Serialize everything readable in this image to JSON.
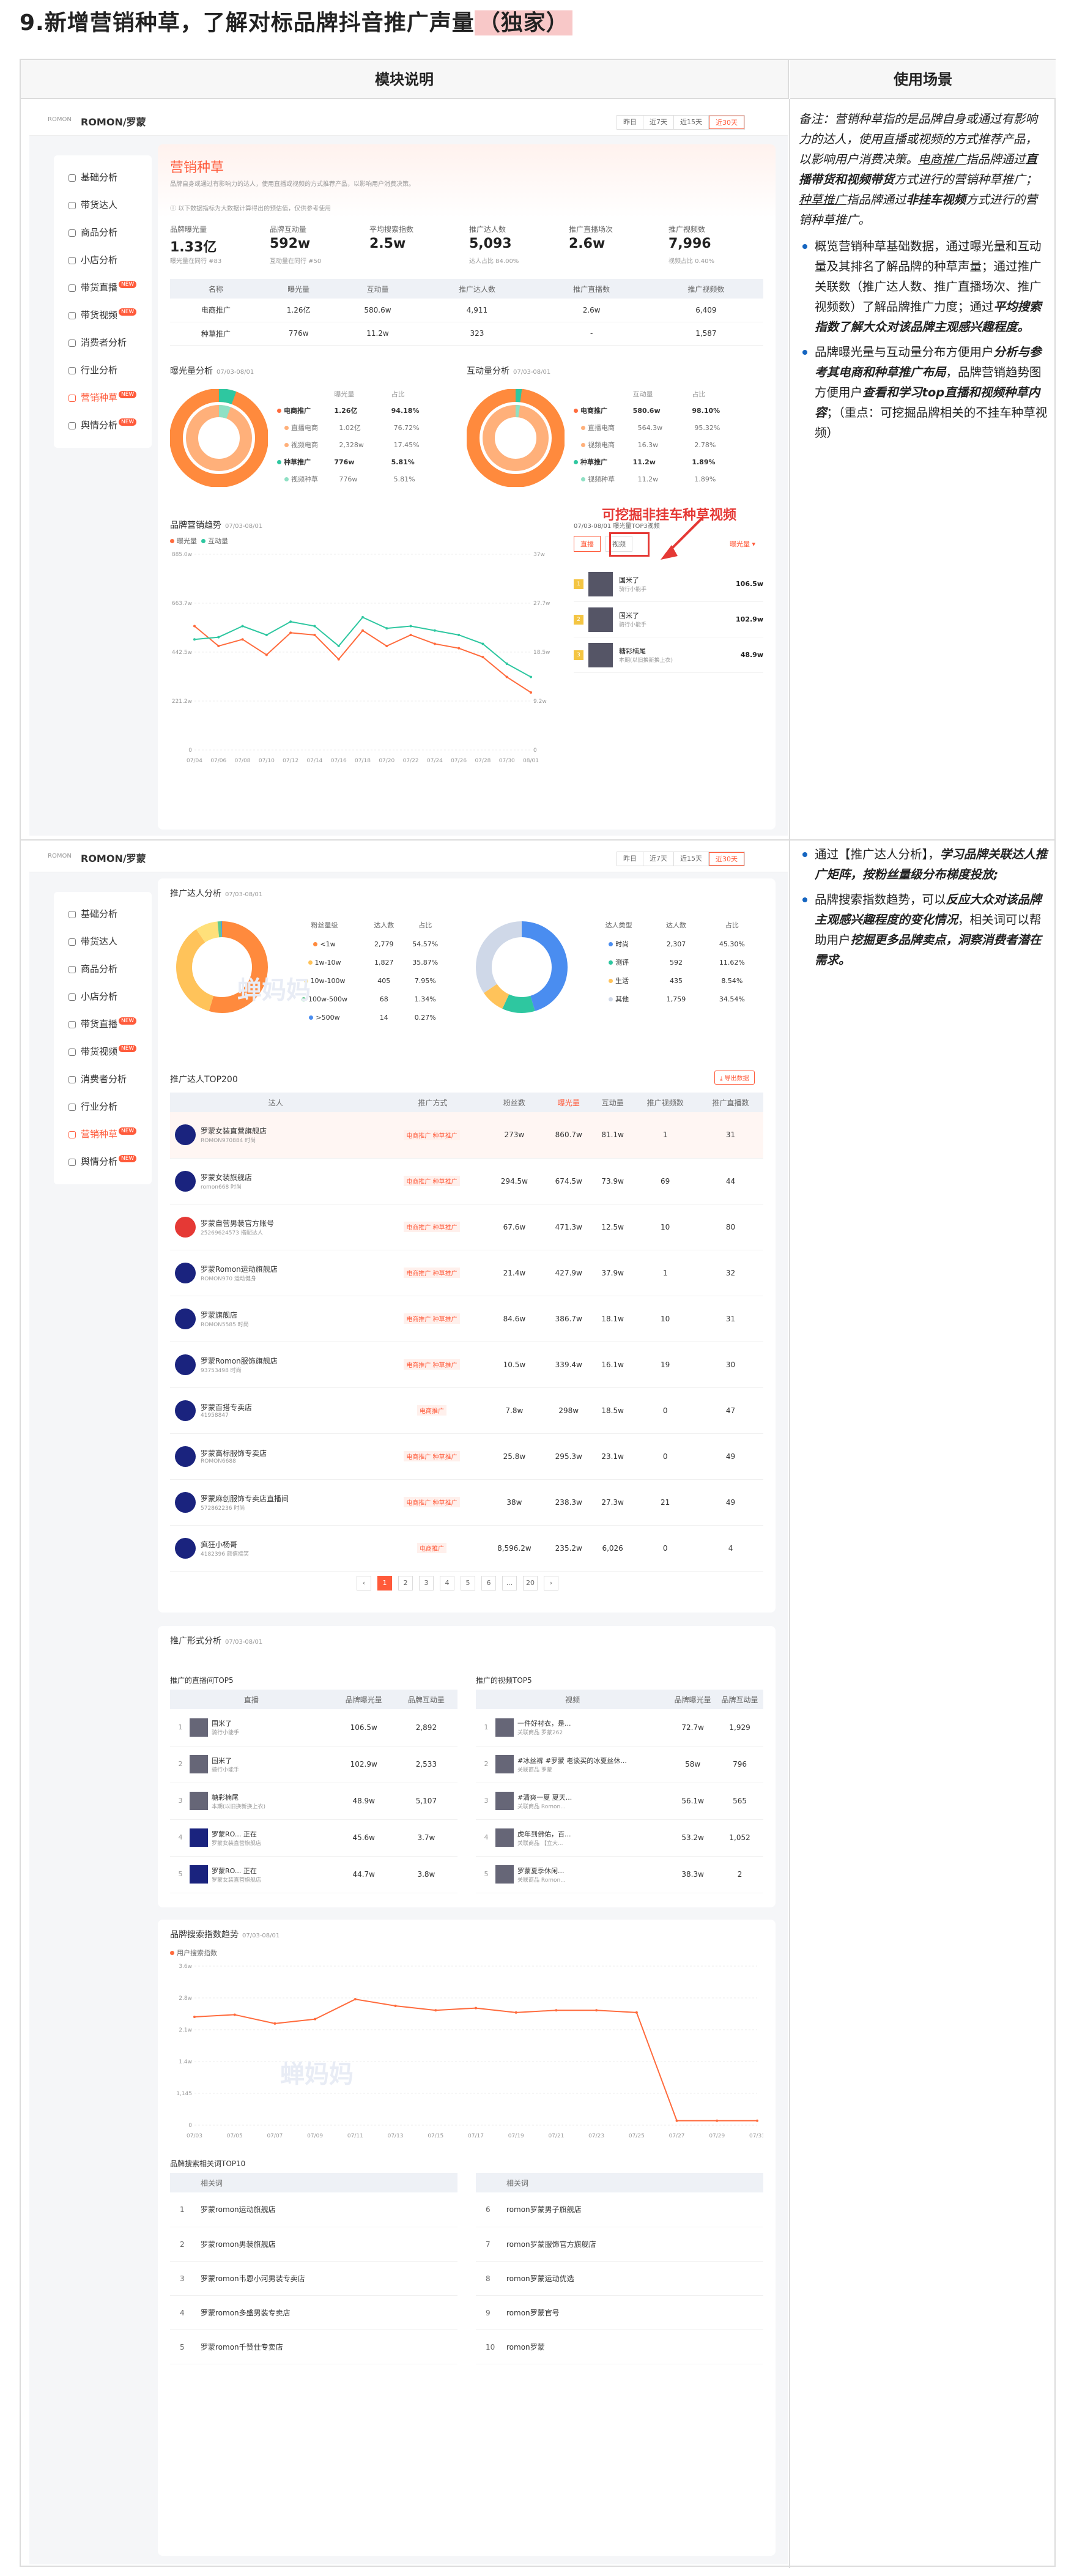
{
  "title": {
    "prefix": "9.新增营销种草，了解对标品牌抖音推广声量",
    "highlight": "（独家）"
  },
  "table_headers": {
    "left": "模块说明",
    "right": "使用场景"
  },
  "notes": {
    "n1_pre": "备注：营销种草指的是品牌自身或通过有影响力的达人，使用直播或视频的方式推荐产品，以影响用户消费决策。",
    "n1_u1": "电商推广",
    "n1_mid": "指品牌通过",
    "n1_b1": "直播带货和视频带货",
    "n1_mid2": "方式进行的营销种草推广；",
    "n1_u2": "种草推广",
    "n1_mid3": "指品牌通过",
    "n1_b2": "非挂车视频",
    "n1_end": "方式进行的营销种草推广。",
    "b1_a": "概览营销种草基础数据，通过曝光量和互动量及其排名了解品牌的种草声量；通过推广关联数（推广达人数、推广直播场次、推广视频数）了解品牌推广力度；通过",
    "b1_b": "平均搜索指数了解大众对该品牌主观感兴趣程度。",
    "b2_a": "品牌曝光量与互动量分布方便用户",
    "b2_b": "分析与参考其电商和种草推广布局",
    "b2_c": "，品牌营销趋势图方便用户",
    "b2_d": "查看和学习top直播和视频种草内容",
    "b2_e": "；（重点：可挖掘品牌相关的不挂车种草视频）",
    "b3_a": "通过【推广达人分析】，",
    "b3_b": "学习品牌关联达人推广矩阵，按粉丝量级分布梯度投放;",
    "b4_a": "品牌搜索指数趋势，可以",
    "b4_b": "反应大众对该品牌主观感兴趣程度的变化情况",
    "b4_c": "，相关词可以帮助用户",
    "b4_d": "挖掘更多品牌卖点，洞察消费者潜在需求。"
  },
  "app": {
    "logo": "ROMON",
    "brand": "ROMON/罗蒙",
    "ranges": [
      "昨日",
      "近7天",
      "近15天",
      "近30天"
    ],
    "range_selected": 3,
    "sidebar": [
      "基础分析",
      "带货达人",
      "商品分析",
      "小店分析",
      "带货直播",
      "带货视频",
      "消费者分析",
      "行业分析",
      "营销种草",
      "舆情分析"
    ],
    "sidebar_new": [
      false,
      false,
      false,
      false,
      true,
      true,
      false,
      false,
      true,
      true
    ],
    "sidebar_selected": 8
  },
  "overview": {
    "title": "营销种草",
    "desc": "品牌自身或通过有影响力的达人，使用直播或视频的方式推荐产品，以影响用户消费决策。",
    "tip": "以下数据指标为大数据计算得出的预估值，仅供参考使用",
    "metrics": [
      {
        "label": "品牌曝光量",
        "value": "1.33亿",
        "sub": "曝光量在同行 #83"
      },
      {
        "label": "品牌互动量",
        "value": "592w",
        "sub": "互动量在同行 #50"
      },
      {
        "label": "平均搜索指数",
        "value": "2.5w",
        "sub": ""
      },
      {
        "label": "推广达人数",
        "value": "5,093",
        "sub": "达人占比 84.00%"
      },
      {
        "label": "推广直播场次",
        "value": "2.6w",
        "sub": ""
      },
      {
        "label": "推广视频数",
        "value": "7,996",
        "sub": "视频占比 0.40%"
      }
    ],
    "table_head": [
      "名称",
      "曝光量",
      "互动量",
      "推广达人数",
      "推广直播数",
      "推广视频数"
    ],
    "table_rows": [
      [
        "电商推广",
        "1.26亿",
        "580.6w",
        "4,911",
        "2.6w",
        "6,409"
      ],
      [
        "种草推广",
        "776w",
        "11.2w",
        "323",
        "-",
        "1,587"
      ]
    ]
  },
  "distribution": {
    "left_title": "曝光量分析",
    "left_date": "07/03-08/01",
    "right_title": "互动量分析",
    "right_date": "07/03-08/01",
    "cols": [
      "曝光量",
      "占比"
    ],
    "cols_r": [
      "互动量",
      "占比"
    ],
    "left_rows": [
      [
        "电商推广",
        "1.26亿",
        "94.18%"
      ],
      [
        "直播电商",
        "1.02亿",
        "76.72%"
      ],
      [
        "视频电商",
        "2,328w",
        "17.45%"
      ],
      [
        "种草推广",
        "776w",
        "5.81%"
      ],
      [
        "视频种草",
        "776w",
        "5.81%"
      ]
    ],
    "right_rows": [
      [
        "电商推广",
        "580.6w",
        "98.10%"
      ],
      [
        "直播电商",
        "564.3w",
        "95.32%"
      ],
      [
        "视频电商",
        "16.3w",
        "2.78%"
      ],
      [
        "种草推广",
        "11.2w",
        "1.89%"
      ],
      [
        "视频种草",
        "11.2w",
        "1.89%"
      ]
    ],
    "left_center": "电商推广",
    "right_center": "电商推广"
  },
  "trend": {
    "title": "品牌营销趋势",
    "date": "07/03-08/01",
    "series_names": [
      "曝光量",
      "互动量"
    ],
    "buttons": [
      "直播",
      "视频"
    ],
    "top_title": "07/03-08/01 曝光量TOP3视频",
    "sort": "曝光量",
    "callout": "可挖掘非挂车种草视频",
    "top": [
      {
        "name": "国米了",
        "sub": "骑行小能手",
        "value": "106.5w"
      },
      {
        "name": "国米了",
        "sub": "骑行小能手",
        "value": "102.9w"
      },
      {
        "name": "糖彩楠尾",
        "sub": "本期(以旧换新换上衣)",
        "value": "48.9w"
      }
    ]
  },
  "chart_data": [
    {
      "type": "line",
      "title": "品牌营销趋势",
      "x": [
        "07/04",
        "07/06",
        "07/08",
        "07/10",
        "07/12",
        "07/14",
        "07/16",
        "07/18",
        "07/20",
        "07/22",
        "07/24",
        "07/26",
        "07/28",
        "07/30",
        "08/01"
      ],
      "yticks_left": [
        "0",
        "221.2w",
        "442.5w",
        "663.7w",
        "885.0w"
      ],
      "yticks_right": [
        "0",
        "9.2w",
        "18.5w",
        "27.7w",
        "37w"
      ],
      "ylim": [
        0,
        885
      ],
      "series": [
        {
          "name": "曝光量",
          "color": "#ff6b3d",
          "values": [
            560,
            470,
            500,
            430,
            530,
            520,
            410,
            540,
            470,
            520,
            480,
            460,
            420,
            330,
            260
          ]
        },
        {
          "name": "互动量",
          "color": "#2ec7a0",
          "values": [
            500,
            510,
            560,
            520,
            580,
            560,
            470,
            600,
            550,
            560,
            540,
            520,
            480,
            390,
            330
          ]
        }
      ]
    },
    {
      "type": "line",
      "title": "品牌搜索指数趋势",
      "x": [
        "07/03",
        "07/05",
        "07/07",
        "07/09",
        "07/11",
        "07/13",
        "07/15",
        "07/17",
        "07/19",
        "07/21",
        "07/23",
        "07/25",
        "07/27",
        "07/29",
        "07/31"
      ],
      "yticks": [
        "0",
        "1,145",
        "1.4w",
        "2.1w",
        "2.8w",
        "3.6w"
      ],
      "ylim": [
        0,
        3.6
      ],
      "series": [
        {
          "name": "用户搜索指数",
          "color": "#ff6b3d",
          "values": [
            2.45,
            2.5,
            2.3,
            2.4,
            2.85,
            2.7,
            2.6,
            2.65,
            2.55,
            2.6,
            2.6,
            2.55,
            0.1,
            0.1,
            0.1
          ]
        }
      ]
    }
  ],
  "influencer": {
    "title": "推广达人分析",
    "date": "07/03-08/01",
    "fan_head": [
      "粉丝量级",
      "达人数",
      "占比"
    ],
    "fan_rows": [
      [
        "<1w",
        "2,779",
        "54.57%"
      ],
      [
        "1w-10w",
        "1,827",
        "35.87%"
      ],
      [
        "10w-100w",
        "405",
        "7.95%"
      ],
      [
        "100w-500w",
        "68",
        "1.34%"
      ],
      [
        ">500w",
        "14",
        "0.27%"
      ]
    ],
    "fan_colors": [
      "#ff8a3d",
      "#ffc35a",
      "#ffe07a",
      "#62c98e",
      "#4a8df0"
    ],
    "type_head": [
      "达人类型",
      "达人数",
      "占比"
    ],
    "type_rows": [
      [
        "时尚",
        "2,307",
        "45.30%"
      ],
      [
        "测评",
        "592",
        "11.62%"
      ],
      [
        "生活",
        "435",
        "8.54%"
      ],
      [
        "其他",
        "1,759",
        "34.54%"
      ]
    ],
    "type_colors": [
      "#4a8df0",
      "#2ec7a0",
      "#ffc35a",
      "#cfd8e8"
    ],
    "top_title": "推广达人TOP200",
    "export": "导出数据",
    "head": [
      "达人",
      "推广方式",
      "粉丝数",
      "曝光量",
      "互动量",
      "推广视频数",
      "推广直播数"
    ],
    "rows": [
      [
        "罗蒙女装直营旗舰店",
        "ROMON970884 时尚",
        "电商推广 种草推广",
        "273w",
        "860.7w",
        "81.1w",
        "1",
        "31"
      ],
      [
        "罗蒙女装旗舰店",
        "romon668 时尚",
        "电商推广 种草推广",
        "294.5w",
        "674.5w",
        "73.9w",
        "69",
        "44"
      ],
      [
        "罗蒙自营男装官方账号",
        "25269624573 搭配达人",
        "电商推广 种草推广",
        "67.6w",
        "471.3w",
        "12.5w",
        "10",
        "80"
      ],
      [
        "罗蒙Romon运动旗舰店",
        "ROMON970 运动健身",
        "电商推广 种草推广",
        "21.4w",
        "427.9w",
        "37.9w",
        "1",
        "32"
      ],
      [
        "罗蒙旗舰店",
        "ROMON5585 时尚",
        "电商推广 种草推广",
        "84.6w",
        "386.7w",
        "18.1w",
        "10",
        "31"
      ],
      [
        "罗蒙Romon服饰旗舰店",
        "93753498 时尚",
        "电商推广 种草推广",
        "10.5w",
        "339.4w",
        "16.1w",
        "19",
        "30"
      ],
      [
        "罗蒙百搭专卖店",
        "41958847",
        "电商推广",
        "7.8w",
        "298w",
        "18.5w",
        "0",
        "47"
      ],
      [
        "罗蒙高标服饰专卖店",
        "ROMON6688",
        "电商推广 种草推广",
        "25.8w",
        "295.3w",
        "23.1w",
        "0",
        "49"
      ],
      [
        "罗蒙麻创服饰专卖店直播间",
        "572862236 时尚",
        "电商推广 种草推广",
        "38w",
        "238.3w",
        "27.3w",
        "21",
        "49"
      ],
      [
        "疯狂小杨哥",
        "4182396 颜值搞笑",
        "电商推广",
        "8,596.2w",
        "235.2w",
        "6,026",
        "0",
        "4"
      ]
    ],
    "pages": [
      "1",
      "2",
      "3",
      "4",
      "5",
      "6",
      "...",
      "20"
    ]
  },
  "promo": {
    "title": "推广形式分析",
    "date": "07/03-08/01",
    "live_title": "推广的直播间TOP5",
    "live_head": [
      "直播",
      "品牌曝光量",
      "品牌互动量"
    ],
    "live_rows": [
      [
        "国米了",
        "骑行小能手",
        "106.5w",
        "2,892"
      ],
      [
        "国米了",
        "骑行小能手",
        "102.9w",
        "2,533"
      ],
      [
        "糖彩楠尾",
        "本期(以旧换新换上衣)",
        "48.9w",
        "5,107"
      ],
      [
        "罗蒙RO... 正在",
        "罗蒙女装直营旗舰店",
        "45.6w",
        "3.7w"
      ],
      [
        "罗蒙RO... 正在",
        "罗蒙女装直营旗舰店",
        "44.7w",
        "3.8w"
      ]
    ],
    "video_title": "推广的视频TOP5",
    "video_head": [
      "视频",
      "品牌曝光量",
      "品牌互动量"
    ],
    "video_rows": [
      [
        "一件好衬衣，是...",
        "关联商品 罗蒙262",
        "72.7w",
        "1,929"
      ],
      [
        "#冰丝裤 #罗蒙 老谈买的冰夏丝休...",
        "关联商品 罗蒙",
        "58w",
        "796"
      ],
      [
        "#清爽一夏 夏天...",
        "关联商品 Romon...",
        "56.1w",
        "565"
      ],
      [
        "虎年到佛佑，百...",
        "关联商品 【立大...",
        "53.2w",
        "1,052"
      ],
      [
        "罗蒙夏季休闲...",
        "关联商品 Romon...",
        "38.3w",
        "2"
      ]
    ]
  },
  "search": {
    "title": "品牌搜索指数趋势",
    "date": "07/03-08/01",
    "legend": "用户搜索指数",
    "rel_title": "品牌搜索相关词TOP10",
    "rel_head": "相关词",
    "left": [
      [
        "1",
        "罗蒙romon运动旗舰店"
      ],
      [
        "2",
        "罗蒙romon男装旗舰店"
      ],
      [
        "3",
        "罗蒙romon韦恩小河男装专卖店"
      ],
      [
        "4",
        "罗蒙romon多盛男装专卖店"
      ],
      [
        "5",
        "罗蒙romon千赞仕专卖店"
      ]
    ],
    "right": [
      [
        "6",
        "romon罗蒙男子旗舰店"
      ],
      [
        "7",
        "romon罗蒙服饰官方旗舰店"
      ],
      [
        "8",
        "romon罗蒙运动优选"
      ],
      [
        "9",
        "romon罗蒙官号"
      ],
      [
        "10",
        "romon罗蒙"
      ]
    ]
  },
  "watermark": "蝉妈妈"
}
